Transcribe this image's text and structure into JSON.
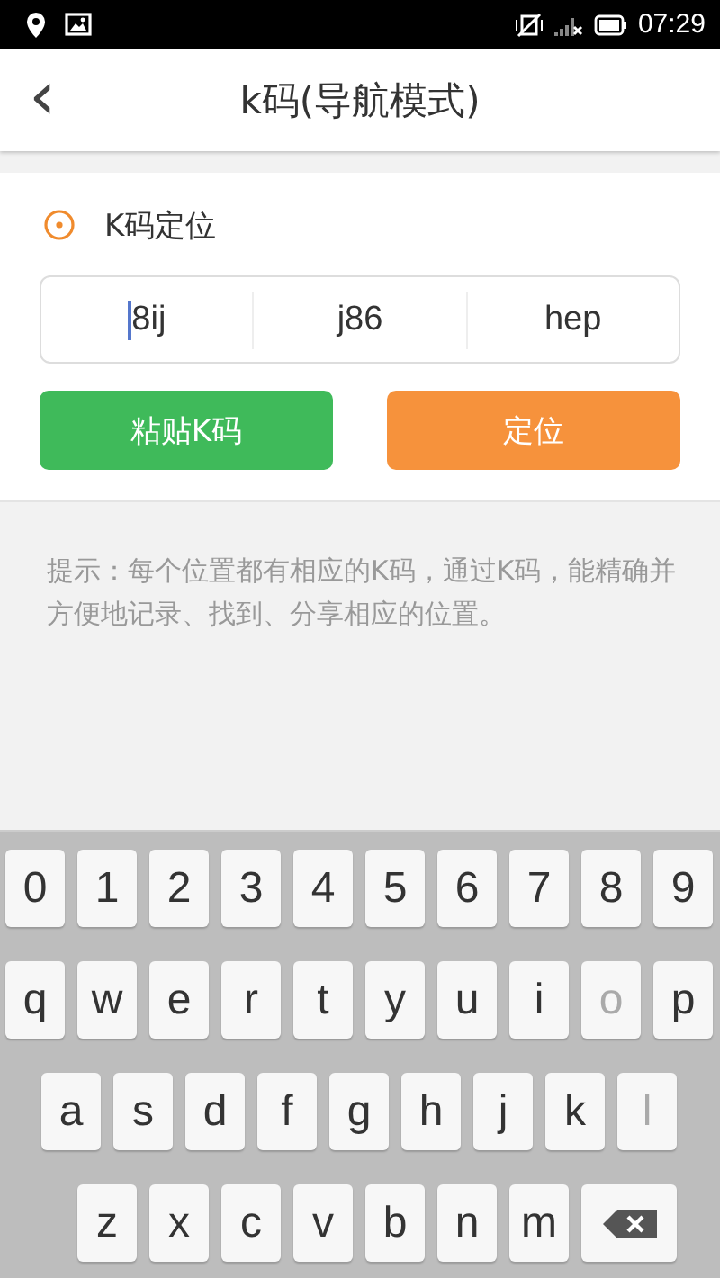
{
  "status_bar": {
    "time": "07:29"
  },
  "header": {
    "back": "‹",
    "title": "k码(导航模式)"
  },
  "section": {
    "title": "K码定位",
    "fields": [
      {
        "value": "8ij",
        "focused": true
      },
      {
        "value": "j86",
        "focused": false
      },
      {
        "value": "hep",
        "focused": false
      }
    ],
    "buttons": [
      {
        "label": "粘贴K码",
        "kind": "paste"
      },
      {
        "label": "定位",
        "kind": "locate"
      }
    ]
  },
  "hint": "提示：每个位置都有相应的K码，通过K码，能精确并方便地记录、找到、分享相应的位置。",
  "keyboard": {
    "rows": [
      {
        "keys": [
          {
            "label": "0",
            "disabled": false
          },
          {
            "label": "1",
            "disabled": false
          },
          {
            "label": "2",
            "disabled": false
          },
          {
            "label": "3",
            "disabled": false
          },
          {
            "label": "4",
            "disabled": false
          },
          {
            "label": "5",
            "disabled": false
          },
          {
            "label": "6",
            "disabled": false
          },
          {
            "label": "7",
            "disabled": false
          },
          {
            "label": "8",
            "disabled": false
          },
          {
            "label": "9",
            "disabled": false
          }
        ]
      },
      {
        "keys": [
          {
            "label": "q",
            "disabled": false
          },
          {
            "label": "w",
            "disabled": false
          },
          {
            "label": "e",
            "disabled": false
          },
          {
            "label": "r",
            "disabled": false
          },
          {
            "label": "t",
            "disabled": false
          },
          {
            "label": "y",
            "disabled": false
          },
          {
            "label": "u",
            "disabled": false
          },
          {
            "label": "i",
            "disabled": false
          },
          {
            "label": "o",
            "disabled": true
          },
          {
            "label": "p",
            "disabled": false
          }
        ]
      },
      {
        "keys": [
          {
            "label": "a",
            "disabled": false
          },
          {
            "label": "s",
            "disabled": false
          },
          {
            "label": "d",
            "disabled": false
          },
          {
            "label": "f",
            "disabled": false
          },
          {
            "label": "g",
            "disabled": false
          },
          {
            "label": "h",
            "disabled": false
          },
          {
            "label": "j",
            "disabled": false
          },
          {
            "label": "k",
            "disabled": false
          },
          {
            "label": "l",
            "disabled": true
          }
        ]
      },
      {
        "keys": [
          {
            "label": "z",
            "disabled": false
          },
          {
            "label": "x",
            "disabled": false
          },
          {
            "label": "c",
            "disabled": false
          },
          {
            "label": "v",
            "disabled": false
          },
          {
            "label": "b",
            "disabled": false
          },
          {
            "label": "n",
            "disabled": false
          },
          {
            "label": "m",
            "disabled": false
          },
          {
            "kind": "delete",
            "disabled": false
          }
        ]
      }
    ]
  }
}
